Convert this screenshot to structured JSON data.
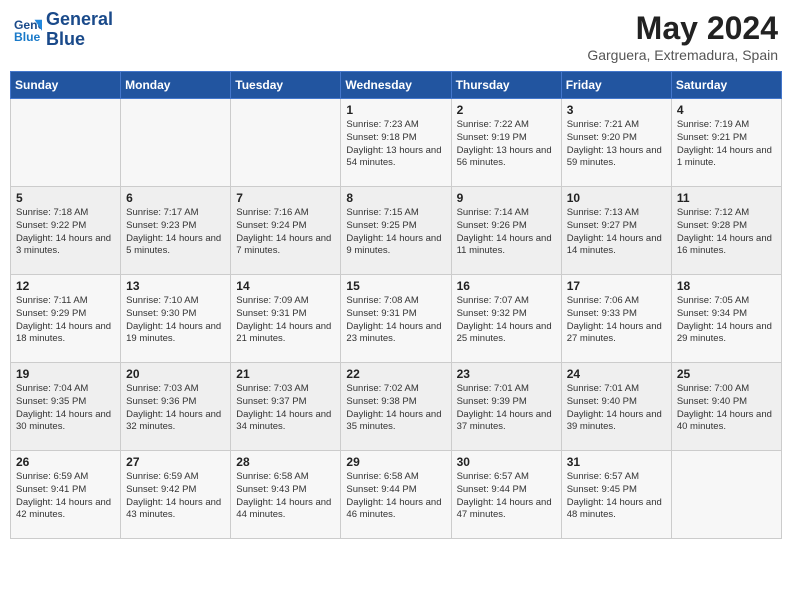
{
  "logo": {
    "line1": "General",
    "line2": "Blue"
  },
  "title": "May 2024",
  "location": "Garguera, Extremadura, Spain",
  "days_of_week": [
    "Sunday",
    "Monday",
    "Tuesday",
    "Wednesday",
    "Thursday",
    "Friday",
    "Saturday"
  ],
  "weeks": [
    [
      {
        "day": "",
        "sunrise": "",
        "sunset": "",
        "daylight": ""
      },
      {
        "day": "",
        "sunrise": "",
        "sunset": "",
        "daylight": ""
      },
      {
        "day": "",
        "sunrise": "",
        "sunset": "",
        "daylight": ""
      },
      {
        "day": "1",
        "sunrise": "Sunrise: 7:23 AM",
        "sunset": "Sunset: 9:18 PM",
        "daylight": "Daylight: 13 hours and 54 minutes."
      },
      {
        "day": "2",
        "sunrise": "Sunrise: 7:22 AM",
        "sunset": "Sunset: 9:19 PM",
        "daylight": "Daylight: 13 hours and 56 minutes."
      },
      {
        "day": "3",
        "sunrise": "Sunrise: 7:21 AM",
        "sunset": "Sunset: 9:20 PM",
        "daylight": "Daylight: 13 hours and 59 minutes."
      },
      {
        "day": "4",
        "sunrise": "Sunrise: 7:19 AM",
        "sunset": "Sunset: 9:21 PM",
        "daylight": "Daylight: 14 hours and 1 minute."
      }
    ],
    [
      {
        "day": "5",
        "sunrise": "Sunrise: 7:18 AM",
        "sunset": "Sunset: 9:22 PM",
        "daylight": "Daylight: 14 hours and 3 minutes."
      },
      {
        "day": "6",
        "sunrise": "Sunrise: 7:17 AM",
        "sunset": "Sunset: 9:23 PM",
        "daylight": "Daylight: 14 hours and 5 minutes."
      },
      {
        "day": "7",
        "sunrise": "Sunrise: 7:16 AM",
        "sunset": "Sunset: 9:24 PM",
        "daylight": "Daylight: 14 hours and 7 minutes."
      },
      {
        "day": "8",
        "sunrise": "Sunrise: 7:15 AM",
        "sunset": "Sunset: 9:25 PM",
        "daylight": "Daylight: 14 hours and 9 minutes."
      },
      {
        "day": "9",
        "sunrise": "Sunrise: 7:14 AM",
        "sunset": "Sunset: 9:26 PM",
        "daylight": "Daylight: 14 hours and 11 minutes."
      },
      {
        "day": "10",
        "sunrise": "Sunrise: 7:13 AM",
        "sunset": "Sunset: 9:27 PM",
        "daylight": "Daylight: 14 hours and 14 minutes."
      },
      {
        "day": "11",
        "sunrise": "Sunrise: 7:12 AM",
        "sunset": "Sunset: 9:28 PM",
        "daylight": "Daylight: 14 hours and 16 minutes."
      }
    ],
    [
      {
        "day": "12",
        "sunrise": "Sunrise: 7:11 AM",
        "sunset": "Sunset: 9:29 PM",
        "daylight": "Daylight: 14 hours and 18 minutes."
      },
      {
        "day": "13",
        "sunrise": "Sunrise: 7:10 AM",
        "sunset": "Sunset: 9:30 PM",
        "daylight": "Daylight: 14 hours and 19 minutes."
      },
      {
        "day": "14",
        "sunrise": "Sunrise: 7:09 AM",
        "sunset": "Sunset: 9:31 PM",
        "daylight": "Daylight: 14 hours and 21 minutes."
      },
      {
        "day": "15",
        "sunrise": "Sunrise: 7:08 AM",
        "sunset": "Sunset: 9:31 PM",
        "daylight": "Daylight: 14 hours and 23 minutes."
      },
      {
        "day": "16",
        "sunrise": "Sunrise: 7:07 AM",
        "sunset": "Sunset: 9:32 PM",
        "daylight": "Daylight: 14 hours and 25 minutes."
      },
      {
        "day": "17",
        "sunrise": "Sunrise: 7:06 AM",
        "sunset": "Sunset: 9:33 PM",
        "daylight": "Daylight: 14 hours and 27 minutes."
      },
      {
        "day": "18",
        "sunrise": "Sunrise: 7:05 AM",
        "sunset": "Sunset: 9:34 PM",
        "daylight": "Daylight: 14 hours and 29 minutes."
      }
    ],
    [
      {
        "day": "19",
        "sunrise": "Sunrise: 7:04 AM",
        "sunset": "Sunset: 9:35 PM",
        "daylight": "Daylight: 14 hours and 30 minutes."
      },
      {
        "day": "20",
        "sunrise": "Sunrise: 7:03 AM",
        "sunset": "Sunset: 9:36 PM",
        "daylight": "Daylight: 14 hours and 32 minutes."
      },
      {
        "day": "21",
        "sunrise": "Sunrise: 7:03 AM",
        "sunset": "Sunset: 9:37 PM",
        "daylight": "Daylight: 14 hours and 34 minutes."
      },
      {
        "day": "22",
        "sunrise": "Sunrise: 7:02 AM",
        "sunset": "Sunset: 9:38 PM",
        "daylight": "Daylight: 14 hours and 35 minutes."
      },
      {
        "day": "23",
        "sunrise": "Sunrise: 7:01 AM",
        "sunset": "Sunset: 9:39 PM",
        "daylight": "Daylight: 14 hours and 37 minutes."
      },
      {
        "day": "24",
        "sunrise": "Sunrise: 7:01 AM",
        "sunset": "Sunset: 9:40 PM",
        "daylight": "Daylight: 14 hours and 39 minutes."
      },
      {
        "day": "25",
        "sunrise": "Sunrise: 7:00 AM",
        "sunset": "Sunset: 9:40 PM",
        "daylight": "Daylight: 14 hours and 40 minutes."
      }
    ],
    [
      {
        "day": "26",
        "sunrise": "Sunrise: 6:59 AM",
        "sunset": "Sunset: 9:41 PM",
        "daylight": "Daylight: 14 hours and 42 minutes."
      },
      {
        "day": "27",
        "sunrise": "Sunrise: 6:59 AM",
        "sunset": "Sunset: 9:42 PM",
        "daylight": "Daylight: 14 hours and 43 minutes."
      },
      {
        "day": "28",
        "sunrise": "Sunrise: 6:58 AM",
        "sunset": "Sunset: 9:43 PM",
        "daylight": "Daylight: 14 hours and 44 minutes."
      },
      {
        "day": "29",
        "sunrise": "Sunrise: 6:58 AM",
        "sunset": "Sunset: 9:44 PM",
        "daylight": "Daylight: 14 hours and 46 minutes."
      },
      {
        "day": "30",
        "sunrise": "Sunrise: 6:57 AM",
        "sunset": "Sunset: 9:44 PM",
        "daylight": "Daylight: 14 hours and 47 minutes."
      },
      {
        "day": "31",
        "sunrise": "Sunrise: 6:57 AM",
        "sunset": "Sunset: 9:45 PM",
        "daylight": "Daylight: 14 hours and 48 minutes."
      },
      {
        "day": "",
        "sunrise": "",
        "sunset": "",
        "daylight": ""
      }
    ]
  ]
}
